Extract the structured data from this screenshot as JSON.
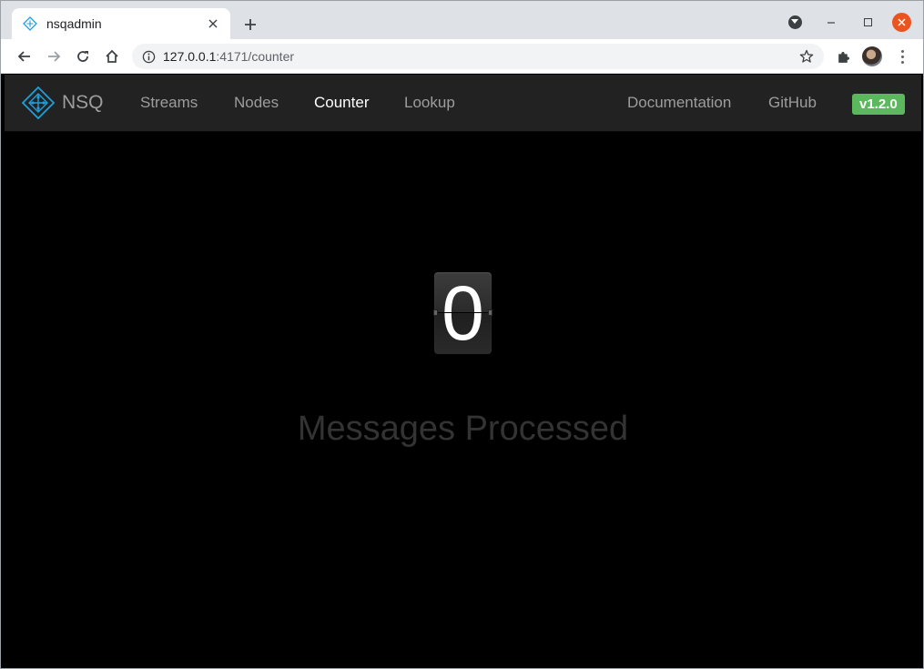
{
  "browser": {
    "tab": {
      "title": "nsqadmin",
      "favicon": "nsq-logo-icon"
    },
    "new_tab_label": "+",
    "url": {
      "host": "127.0.0.1",
      "rest": ":4171/counter"
    }
  },
  "navbar": {
    "brand": "NSQ",
    "links": [
      "Streams",
      "Nodes",
      "Counter",
      "Lookup"
    ],
    "active": "Counter",
    "right_links": [
      "Documentation",
      "GitHub"
    ],
    "version": "v1.2.0",
    "version_color": "#5cb85c"
  },
  "counter": {
    "value": "0",
    "label": "Messages Processed"
  }
}
